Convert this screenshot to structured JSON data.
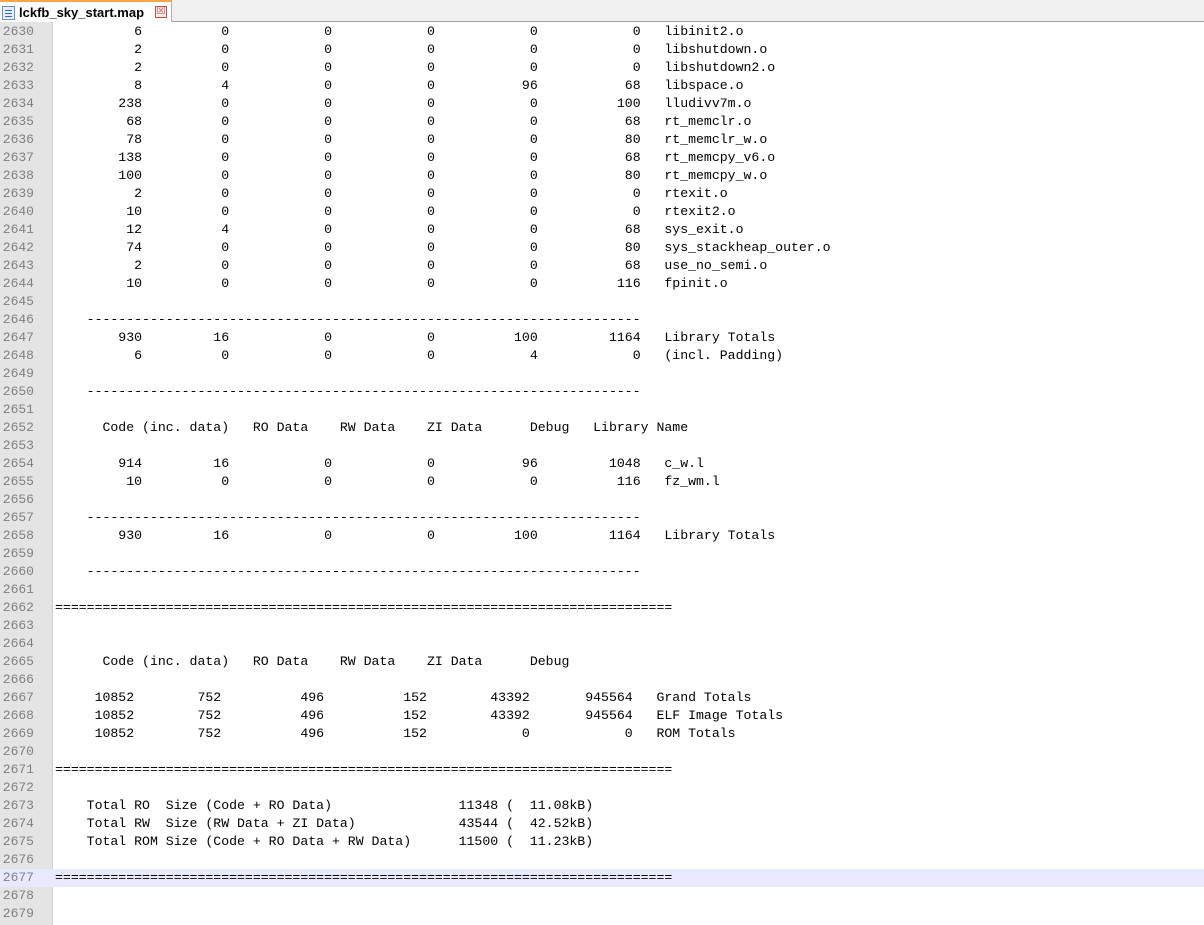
{
  "tab": {
    "filename": "lckfb_sky_start.map",
    "close_glyph": "☒"
  },
  "editor": {
    "current_line": 2677,
    "lines": [
      {
        "num": "2630",
        "text": "          6          0            0            0            0            0   libinit2.o"
      },
      {
        "num": "2631",
        "text": "          2          0            0            0            0            0   libshutdown.o"
      },
      {
        "num": "2632",
        "text": "          2          0            0            0            0            0   libshutdown2.o"
      },
      {
        "num": "2633",
        "text": "          8          4            0            0           96           68   libspace.o"
      },
      {
        "num": "2634",
        "text": "        238          0            0            0            0          100   lludivv7m.o"
      },
      {
        "num": "2635",
        "text": "         68          0            0            0            0           68   rt_memclr.o"
      },
      {
        "num": "2636",
        "text": "         78          0            0            0            0           80   rt_memclr_w.o"
      },
      {
        "num": "2637",
        "text": "        138          0            0            0            0           68   rt_memcpy_v6.o"
      },
      {
        "num": "2638",
        "text": "        100          0            0            0            0           80   rt_memcpy_w.o"
      },
      {
        "num": "2639",
        "text": "          2          0            0            0            0            0   rtexit.o"
      },
      {
        "num": "2640",
        "text": "         10          0            0            0            0            0   rtexit2.o"
      },
      {
        "num": "2641",
        "text": "         12          4            0            0            0           68   sys_exit.o"
      },
      {
        "num": "2642",
        "text": "         74          0            0            0            0           80   sys_stackheap_outer.o"
      },
      {
        "num": "2643",
        "text": "          2          0            0            0            0           68   use_no_semi.o"
      },
      {
        "num": "2644",
        "text": "         10          0            0            0            0          116   fpinit.o"
      },
      {
        "num": "2645",
        "text": ""
      },
      {
        "num": "2646",
        "text": "    ----------------------------------------------------------------------"
      },
      {
        "num": "2647",
        "text": "        930         16            0            0          100         1164   Library Totals"
      },
      {
        "num": "2648",
        "text": "          6          0            0            0            4            0   (incl. Padding)"
      },
      {
        "num": "2649",
        "text": ""
      },
      {
        "num": "2650",
        "text": "    ----------------------------------------------------------------------"
      },
      {
        "num": "2651",
        "text": ""
      },
      {
        "num": "2652",
        "text": "      Code (inc. data)   RO Data    RW Data    ZI Data      Debug   Library Name"
      },
      {
        "num": "2653",
        "text": ""
      },
      {
        "num": "2654",
        "text": "        914         16            0            0           96         1048   c_w.l"
      },
      {
        "num": "2655",
        "text": "         10          0            0            0            0          116   fz_wm.l"
      },
      {
        "num": "2656",
        "text": ""
      },
      {
        "num": "2657",
        "text": "    ----------------------------------------------------------------------"
      },
      {
        "num": "2658",
        "text": "        930         16            0            0          100         1164   Library Totals"
      },
      {
        "num": "2659",
        "text": ""
      },
      {
        "num": "2660",
        "text": "    ----------------------------------------------------------------------"
      },
      {
        "num": "2661",
        "text": ""
      },
      {
        "num": "2662",
        "text": "=============================================================================="
      },
      {
        "num": "2663",
        "text": ""
      },
      {
        "num": "2664",
        "text": ""
      },
      {
        "num": "2665",
        "text": "      Code (inc. data)   RO Data    RW Data    ZI Data      Debug   "
      },
      {
        "num": "2666",
        "text": ""
      },
      {
        "num": "2667",
        "text": "     10852        752          496          152        43392       945564   Grand Totals"
      },
      {
        "num": "2668",
        "text": "     10852        752          496          152        43392       945564   ELF Image Totals"
      },
      {
        "num": "2669",
        "text": "     10852        752          496          152            0            0   ROM Totals"
      },
      {
        "num": "2670",
        "text": ""
      },
      {
        "num": "2671",
        "text": "=============================================================================="
      },
      {
        "num": "2672",
        "text": ""
      },
      {
        "num": "2673",
        "text": "    Total RO  Size (Code + RO Data)                11348 (  11.08kB)"
      },
      {
        "num": "2674",
        "text": "    Total RW  Size (RW Data + ZI Data)             43544 (  42.52kB)"
      },
      {
        "num": "2675",
        "text": "    Total ROM Size (Code + RO Data + RW Data)      11500 (  11.23kB)"
      },
      {
        "num": "2676",
        "text": ""
      },
      {
        "num": "2677",
        "text": "=============================================================================="
      },
      {
        "num": "2678",
        "text": ""
      },
      {
        "num": "2679",
        "text": ""
      }
    ]
  }
}
